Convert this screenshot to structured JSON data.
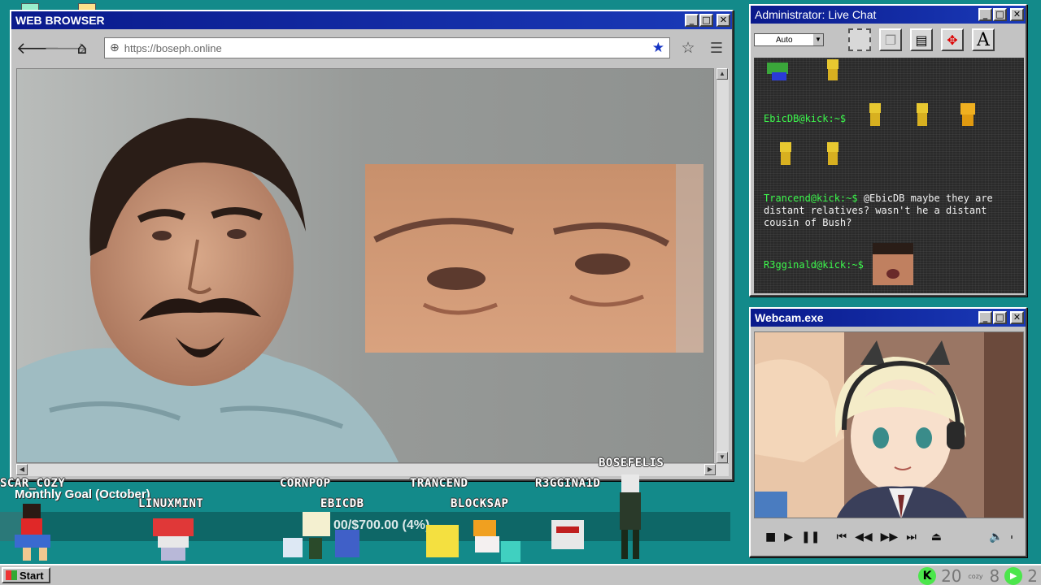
{
  "browser": {
    "title": "WEB BROWSER",
    "url": "https://boseph.online",
    "title_buttons": [
      "_",
      "□",
      "✕"
    ]
  },
  "chat": {
    "title": "Administrator: Live Chat",
    "font_size_select": "Auto",
    "messages": [
      {
        "user": "EbicDB@kick:~$",
        "text": ""
      },
      {
        "user": "Trancend@kick:~$",
        "text": "@EbicDB maybe they are distant relatives? wasn't he a distant cousin of Bush?"
      },
      {
        "user": "R3gginald@kick:~$",
        "text": ""
      }
    ]
  },
  "webcam": {
    "title": "Webcam.exe"
  },
  "overlay": {
    "goal_title": "Monthly Goal (October)",
    "goal_text": "00/$700.00 (4%)",
    "goal_fraction": 0.04,
    "names": [
      "SCAR_COZY",
      "LINUXMINT",
      "CORNPOP",
      "EBICDB",
      "TRANCEND",
      "BLOCKSAP",
      "R3GGINA1D",
      "BOSEFELIS"
    ]
  },
  "taskbar": {
    "start_label": "Start",
    "count_left": "20",
    "count_right": "8",
    "count_play": "2",
    "cozy_label": "cozy"
  },
  "colors": {
    "desktop": "#138a8a",
    "titlebar": "#0a1a8c",
    "chat_user": "#3cf74c",
    "kick_green": "#4be64b"
  }
}
